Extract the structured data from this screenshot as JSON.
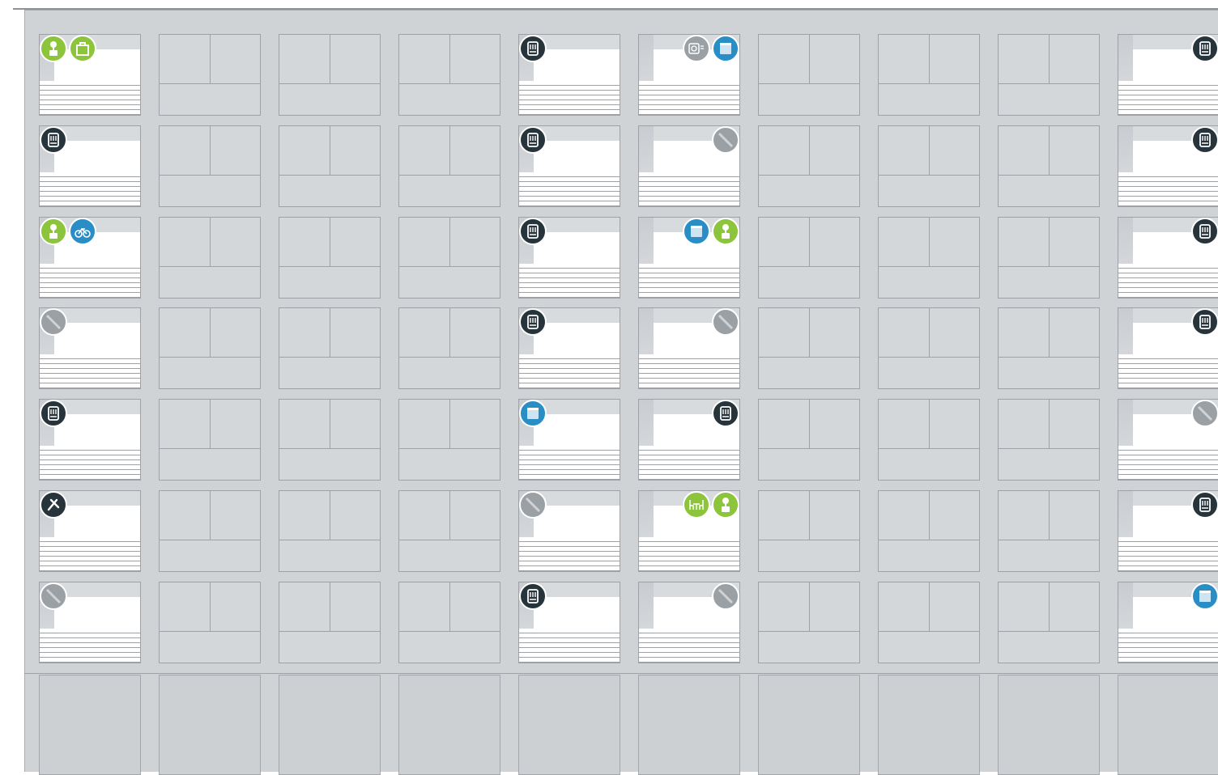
{
  "colors": {
    "wall": "#d0d3d6",
    "green": "#8cc43c",
    "blue": "#2a8ec6",
    "dark": "#27343c",
    "gray": "#9aa0a4"
  },
  "grid": {
    "columns": 10,
    "rows": 7
  },
  "open_columns": [
    0,
    4,
    5,
    9
  ],
  "icon_legend": {
    "plant-icon": "green",
    "bag-icon": "green",
    "bike-icon": "blue",
    "locker-icon": "dark",
    "no-entry-icon": "gray",
    "bin-icon": "blue",
    "kitchen-icon": "gray",
    "tools-icon": "dark",
    "dining-icon": "green"
  },
  "windows": [
    {
      "row": 0,
      "col": 0,
      "align": "left",
      "icons": [
        "plant-icon",
        "bag-icon"
      ]
    },
    {
      "row": 0,
      "col": 4,
      "align": "left",
      "icons": [
        "locker-icon"
      ]
    },
    {
      "row": 0,
      "col": 5,
      "align": "right",
      "icons": [
        "kitchen-icon",
        "bin-icon"
      ]
    },
    {
      "row": 0,
      "col": 9,
      "align": "right",
      "icons": [
        "locker-icon"
      ]
    },
    {
      "row": 1,
      "col": 0,
      "align": "left",
      "icons": [
        "locker-icon"
      ]
    },
    {
      "row": 1,
      "col": 4,
      "align": "left",
      "icons": [
        "locker-icon"
      ]
    },
    {
      "row": 1,
      "col": 5,
      "align": "right",
      "icons": [
        "no-entry-icon"
      ]
    },
    {
      "row": 1,
      "col": 9,
      "align": "right",
      "icons": [
        "locker-icon"
      ]
    },
    {
      "row": 2,
      "col": 0,
      "align": "left",
      "icons": [
        "plant-icon",
        "bike-icon"
      ]
    },
    {
      "row": 2,
      "col": 4,
      "align": "left",
      "icons": [
        "locker-icon"
      ]
    },
    {
      "row": 2,
      "col": 5,
      "align": "right",
      "icons": [
        "bin-icon",
        "plant-icon"
      ]
    },
    {
      "row": 2,
      "col": 9,
      "align": "right",
      "icons": [
        "locker-icon"
      ]
    },
    {
      "row": 3,
      "col": 0,
      "align": "left",
      "icons": [
        "no-entry-icon"
      ]
    },
    {
      "row": 3,
      "col": 4,
      "align": "left",
      "icons": [
        "locker-icon"
      ]
    },
    {
      "row": 3,
      "col": 5,
      "align": "right",
      "icons": [
        "no-entry-icon"
      ]
    },
    {
      "row": 3,
      "col": 9,
      "align": "right",
      "icons": [
        "locker-icon"
      ]
    },
    {
      "row": 4,
      "col": 0,
      "align": "left",
      "icons": [
        "locker-icon"
      ]
    },
    {
      "row": 4,
      "col": 4,
      "align": "left",
      "icons": [
        "bin-icon"
      ]
    },
    {
      "row": 4,
      "col": 5,
      "align": "right",
      "icons": [
        "locker-icon"
      ]
    },
    {
      "row": 4,
      "col": 9,
      "align": "right",
      "icons": [
        "no-entry-icon"
      ]
    },
    {
      "row": 5,
      "col": 0,
      "align": "left",
      "icons": [
        "tools-icon"
      ]
    },
    {
      "row": 5,
      "col": 4,
      "align": "left",
      "icons": [
        "no-entry-icon"
      ]
    },
    {
      "row": 5,
      "col": 5,
      "align": "right",
      "icons": [
        "dining-icon",
        "plant-icon"
      ]
    },
    {
      "row": 5,
      "col": 9,
      "align": "right",
      "icons": [
        "locker-icon"
      ]
    },
    {
      "row": 6,
      "col": 0,
      "align": "left",
      "icons": [
        "no-entry-icon"
      ]
    },
    {
      "row": 6,
      "col": 4,
      "align": "left",
      "icons": [
        "locker-icon"
      ]
    },
    {
      "row": 6,
      "col": 5,
      "align": "right",
      "icons": [
        "no-entry-icon"
      ]
    },
    {
      "row": 6,
      "col": 9,
      "align": "right",
      "icons": [
        "bin-icon"
      ]
    }
  ]
}
